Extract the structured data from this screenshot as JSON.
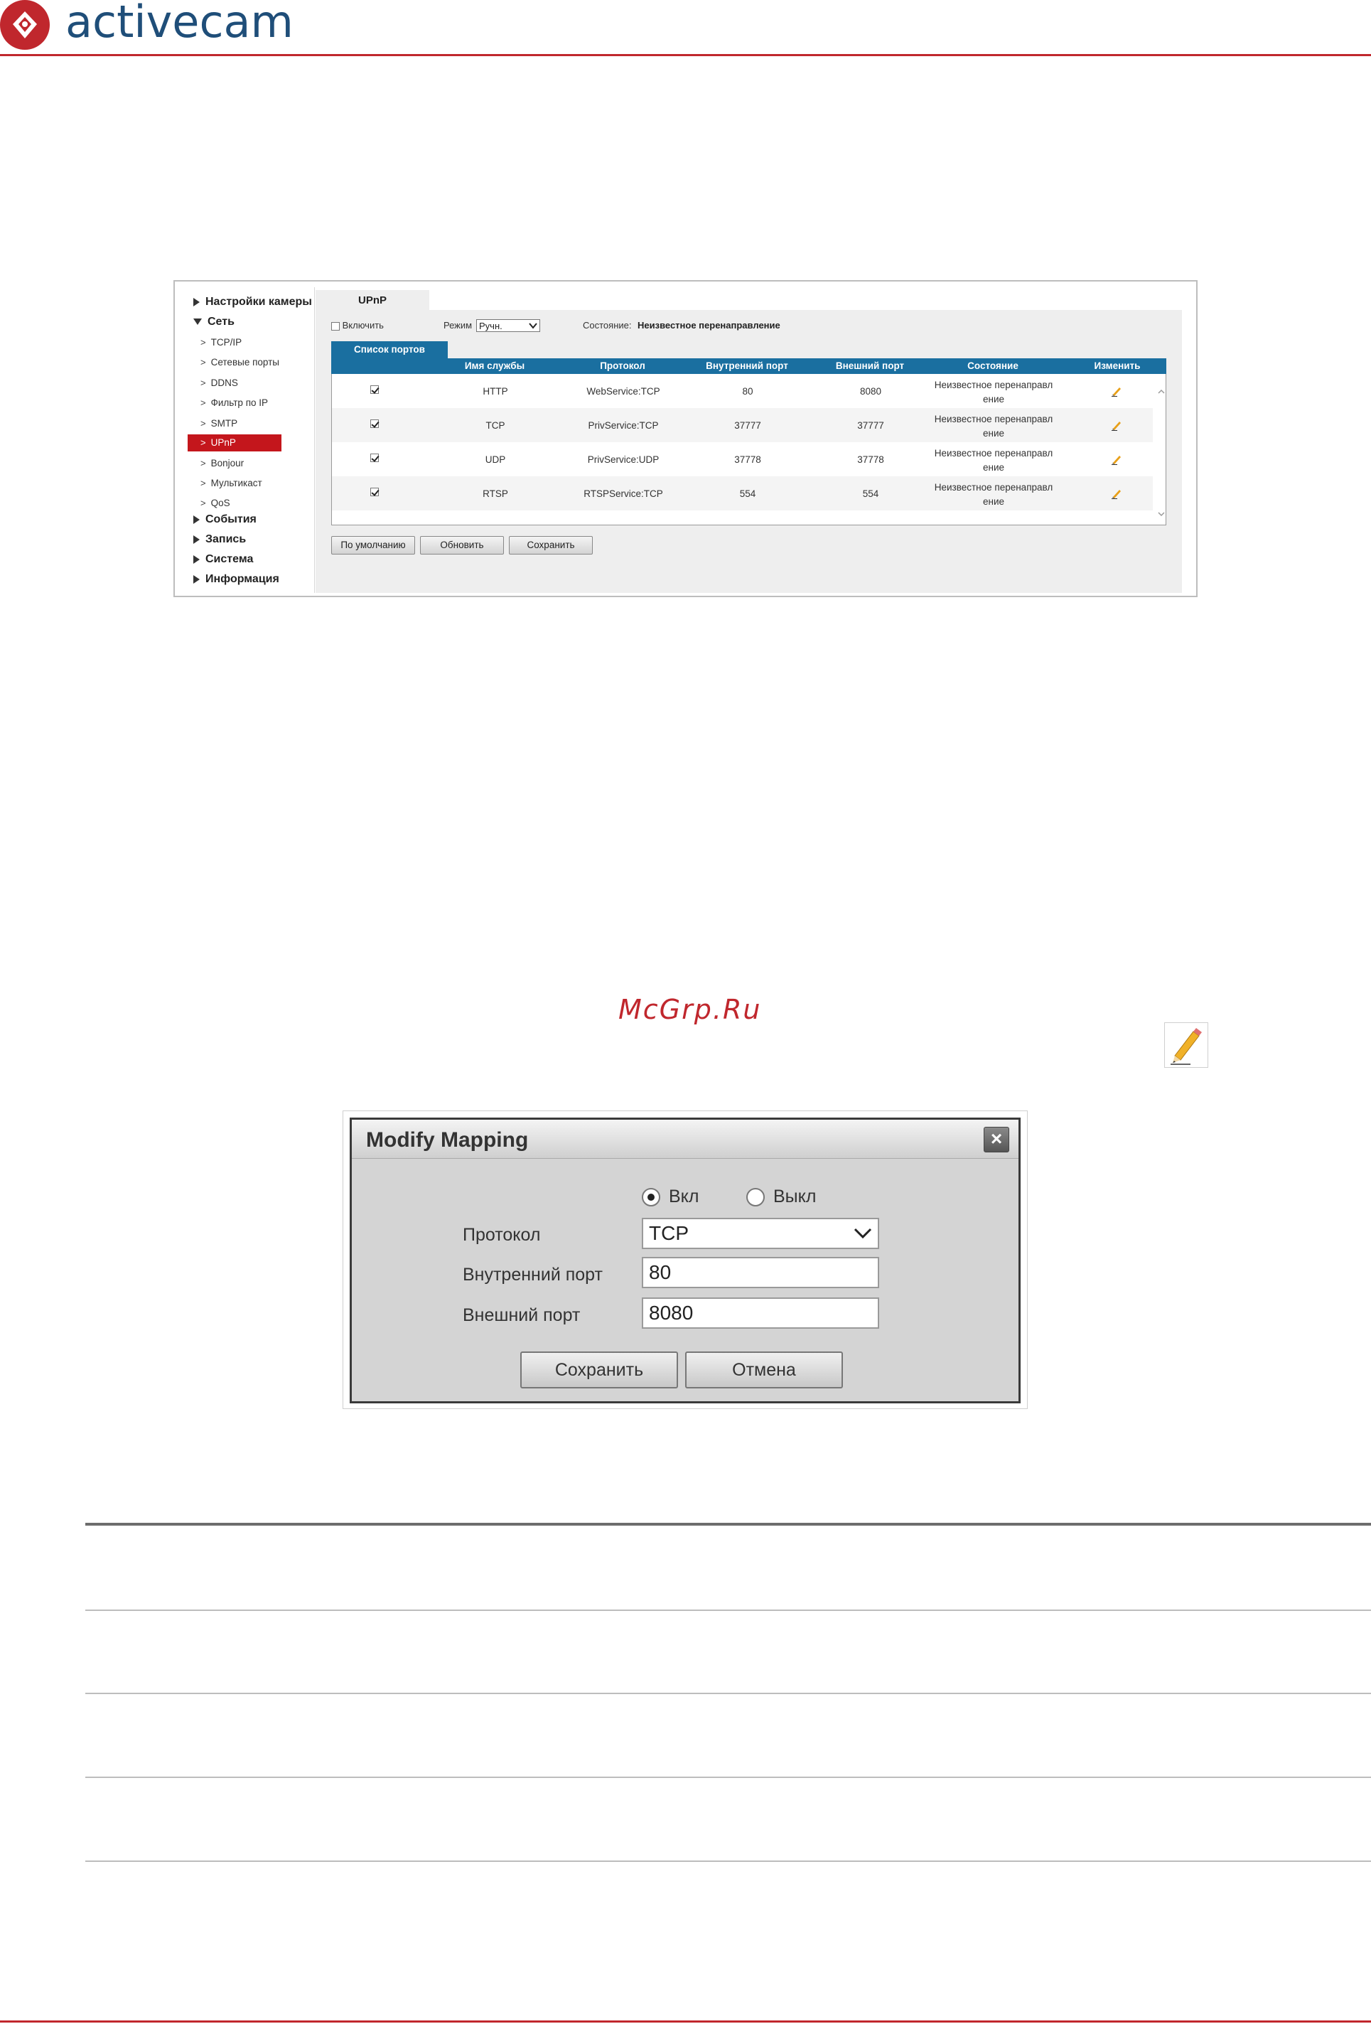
{
  "header": {
    "brand": "activecam"
  },
  "settings": {
    "sidebar": {
      "groups": [
        {
          "label": "Настройки камеры"
        },
        {
          "label": "Сеть"
        },
        {
          "label": "События"
        },
        {
          "label": "Запись"
        },
        {
          "label": "Система"
        },
        {
          "label": "Информация"
        }
      ],
      "network_items": [
        "TCP/IP",
        "Сетевые порты",
        "DDNS",
        "Фильтр по IP",
        "SMTP",
        "UPnP",
        "Bonjour",
        "Мультикаст",
        "QoS"
      ],
      "active_item": "UPnP"
    },
    "tab_label": "UPnP",
    "enable_label": "Включить",
    "enable_checked": false,
    "mode_label": "Режим",
    "mode_value": "Ручн.",
    "status_label": "Состояние:",
    "status_value": "Неизвестное перенаправление",
    "ports_tab": "Список портов",
    "columns": [
      "Имя службы",
      "Протокол",
      "Внутренний порт",
      "Внешний порт",
      "Состояние",
      "Изменить"
    ],
    "rows": [
      {
        "checked": true,
        "service": "HTTP",
        "protocol": "WebService:TCP",
        "internal": "80",
        "external": "8080",
        "state1": "Неизвестное перенаправл",
        "state2": "ение"
      },
      {
        "checked": true,
        "service": "TCP",
        "protocol": "PrivService:TCP",
        "internal": "37777",
        "external": "37777",
        "state1": "Неизвестное перенаправл",
        "state2": "ение"
      },
      {
        "checked": true,
        "service": "UDP",
        "protocol": "PrivService:UDP",
        "internal": "37778",
        "external": "37778",
        "state1": "Неизвестное перенаправл",
        "state2": "ение"
      },
      {
        "checked": true,
        "service": "RTSP",
        "protocol": "RTSPService:TCP",
        "internal": "554",
        "external": "554",
        "state1": "Неизвестное перенаправл",
        "state2": "ение"
      }
    ],
    "buttons": {
      "default": "По умолчанию",
      "refresh": "Обновить",
      "save": "Сохранить"
    }
  },
  "watermark": "McGrp.Ru",
  "dialog": {
    "title": "Modify Mapping",
    "on_label": "Вкл",
    "off_label": "Выкл",
    "selected": "on",
    "protocol_label": "Протокол",
    "protocol_value": "TCP",
    "internal_label": "Внутренний порт",
    "internal_value": "80",
    "external_label": "Внешний порт",
    "external_value": "8080",
    "save_label": "Сохранить",
    "cancel_label": "Отмена"
  },
  "colors": {
    "brand_red": "#c0272d",
    "brand_blue": "#1f4e79",
    "table_header": "#1a6fa0",
    "active_nav": "#c4161c"
  },
  "icons": [
    "activecam-logo-icon",
    "pencil-icon",
    "close-icon",
    "chevron-down-icon"
  ]
}
